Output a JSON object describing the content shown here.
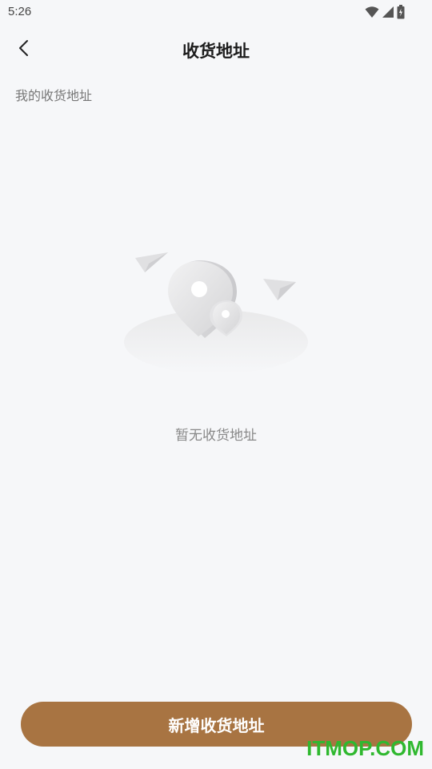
{
  "status_bar": {
    "time": "5:26",
    "icons": [
      "wifi-icon",
      "cellular-signal-icon",
      "battery-icon"
    ]
  },
  "header": {
    "back_icon": "chevron-left-icon",
    "title": "收货地址"
  },
  "section": {
    "label": "我的收货地址"
  },
  "empty_state": {
    "illustration": "location-pin-with-paper-planes",
    "message": "暂无收货地址"
  },
  "footer": {
    "add_button_label": "新增收货地址"
  },
  "watermark": {
    "text": "ITMOP.COM"
  },
  "colors": {
    "background": "#f6f7f9",
    "accent_button": "#a87442",
    "watermark": "#2fb82f"
  }
}
